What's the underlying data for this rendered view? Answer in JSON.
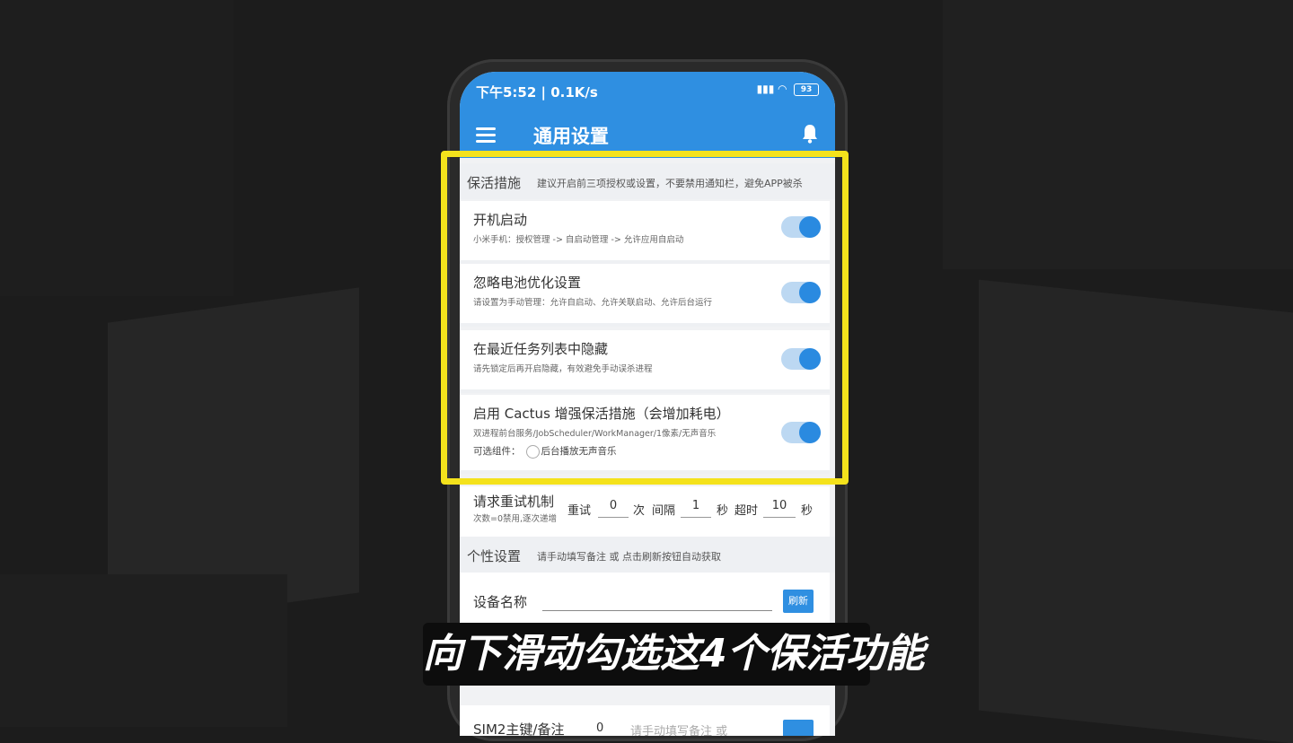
{
  "status_bar": {
    "left_text": "下午5:52 | 0.1K/s",
    "battery": "93"
  },
  "app_bar": {
    "title": "通用设置",
    "icons": [
      "menu-icon",
      "bell-icon"
    ]
  },
  "keepalive_section": {
    "title": "保活措施",
    "hint": "建议开启前三项授权或设置，不要禁用通知栏，避免APP被杀",
    "items": [
      {
        "title": "开机启动",
        "subtitle": "小米手机：授权管理 -> 自启动管理 -> 允许应用自启动",
        "enabled": true
      },
      {
        "title": "忽略电池优化设置",
        "subtitle": "请设置为手动管理：允许自启动、允许关联启动、允许后台运行",
        "enabled": true
      },
      {
        "title": "在最近任务列表中隐藏",
        "subtitle": "请先锁定后再开启隐藏，有效避免手动误杀进程",
        "enabled": true
      },
      {
        "title": "启用 Cactus 增强保活措施（会增加耗电）",
        "subtitle": "双进程前台服务/JobScheduler/WorkManager/1像素/无声音乐",
        "enabled": true
      }
    ],
    "optional_label": "可选组件：",
    "optional_option": "后台播放无声音乐"
  },
  "retry": {
    "title": "请求重试机制",
    "subtitle": "次数=0禁用,逐次递增",
    "retry_label": "重试",
    "retry_value": "0",
    "times_unit": "次",
    "interval_label": "间隔",
    "interval_value": "1",
    "sec_unit_1": "秒",
    "timeout_label": "超时",
    "timeout_value": "10",
    "sec_unit_2": "秒"
  },
  "personal_section": {
    "title": "个性设置",
    "hint": "请手动填写备注 或 点击刷新按钮自动获取",
    "device_label": "设备名称",
    "device_value": "",
    "refresh_label": "刷新"
  },
  "sim2": {
    "label": "SIM2主键/备注",
    "value": "0",
    "placeholder": "请手动填写备注 或"
  },
  "caption": "向下滑动勾选这4个保活功能",
  "colors": {
    "accent": "#2f8fe1",
    "highlight": "#f4e21c",
    "toggle_on": "#2a8ae0"
  }
}
